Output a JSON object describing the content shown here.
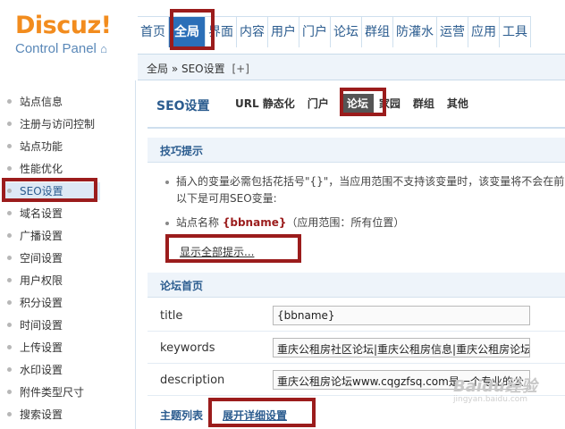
{
  "logo": {
    "main": "Discuz!",
    "sub": "Control Panel"
  },
  "topnav": [
    "首页",
    "全局",
    "界面",
    "内容",
    "用户",
    "门户",
    "论坛",
    "群组",
    "防灌水",
    "运营",
    "应用",
    "工具"
  ],
  "breadcrumb": {
    "text": "全局 » SEO设置",
    "plus": "[+]"
  },
  "sidebar": [
    "站点信息",
    "注册与访问控制",
    "站点功能",
    "性能优化",
    "SEO设置",
    "域名设置",
    "广播设置",
    "空间设置",
    "用户权限",
    "积分设置",
    "时间设置",
    "上传设置",
    "水印设置",
    "附件类型尺寸",
    "搜索设置"
  ],
  "main": {
    "title": "SEO设置",
    "tabs": [
      "URL 静态化",
      "门户",
      "论坛",
      "家园",
      "群组",
      "其他"
    ],
    "tips_head": "技巧提示",
    "tip1": "插入的变量必需包括花括号\"{}\"，当应用范围不支持该变量时，该变量将不会在前",
    "tip1b": "以下是可用SEO变量:",
    "tip2_pre": "站点名称 ",
    "tip2_var": "{bbname}",
    "tip2_post": "（应用范围：所有位置）",
    "show_all": "显示全部提示...",
    "forum_head": "论坛首页",
    "rows": [
      {
        "label": "title",
        "value": "{bbname}"
      },
      {
        "label": "keywords",
        "value": "重庆公租房社区论坛|重庆公租房信息|重庆公租房论坛"
      },
      {
        "label": "description",
        "value": "重庆公租房论坛www.cqgzfsq.com是一个专业的公"
      }
    ],
    "list_head": "主题列表",
    "expand": "展开详细设置"
  },
  "watermark": {
    "brand": "Baidu经验",
    "url": "jingyan.baidu.com"
  }
}
